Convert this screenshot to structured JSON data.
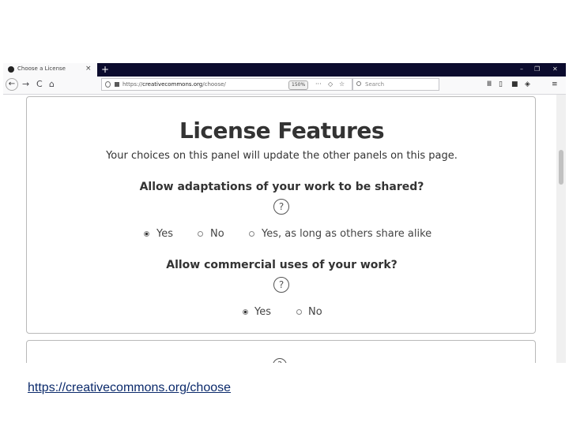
{
  "browser": {
    "tab_title": "Choose a License",
    "new_tab": "+",
    "close_tab": "×",
    "window_controls": {
      "minimize": "–",
      "restore": "❐",
      "close": "✕"
    },
    "nav": {
      "back": "←",
      "forward": "→",
      "reload": "C",
      "home": "⌂"
    },
    "url_prefix": "https://",
    "url_domain": "creativecommons.org",
    "url_path": "/choose/",
    "zoom": "150%",
    "url_more": "···",
    "search_placeholder": "Search",
    "toolbar_icons": [
      "library-icon",
      "reader-view-icon",
      "addon-icon",
      "extension-icon",
      "menu-icon"
    ]
  },
  "panel": {
    "title": "License Features",
    "subtitle": "Your choices on this panel will update the other panels on this page.",
    "q1": {
      "question": "Allow adaptations of your work to be shared?",
      "help": "?",
      "options": [
        "Yes",
        "No",
        "Yes, as long as others share alike"
      ],
      "selected": "Yes"
    },
    "q2": {
      "question": "Allow commercial uses of your work?",
      "help": "?",
      "options": [
        "Yes",
        "No"
      ],
      "selected": "Yes"
    }
  },
  "panel2": {
    "help": "?"
  },
  "footer": {
    "link": "https://creativecommons.org/choose"
  }
}
